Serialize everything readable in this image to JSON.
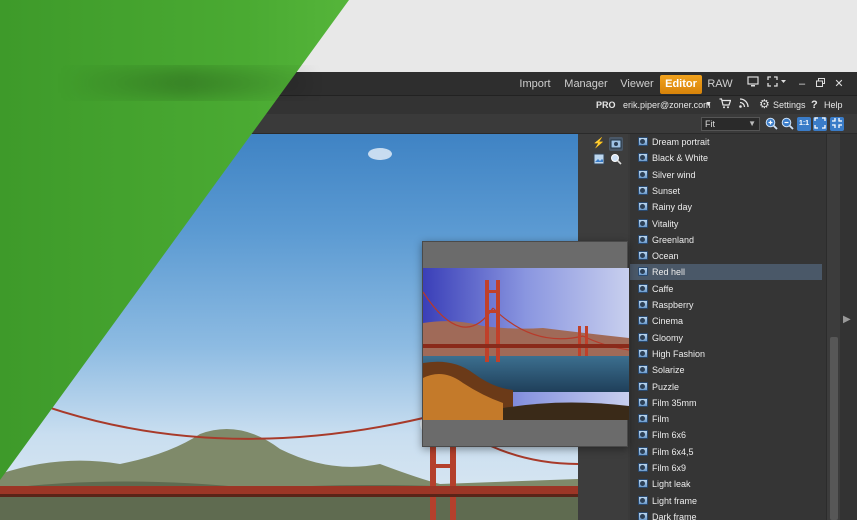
{
  "modules": {
    "import": "Import",
    "manager": "Manager",
    "viewer": "Viewer",
    "editor": "Editor",
    "raw": "RAW"
  },
  "window_controls": {
    "minimize": "‒",
    "restore": "🗗",
    "close": "✕"
  },
  "account": {
    "edition": "PRO",
    "email": "erik.piper@zoner.com",
    "settings": "Settings",
    "help": "Help"
  },
  "toolbar": {
    "zoom_value": "Fit"
  },
  "filters": {
    "selected": "Red hell",
    "items": [
      "Dream portrait",
      "Black & White",
      "Silver wind",
      "Sunset",
      "Rainy day",
      "Vitality",
      "Greenland",
      "Ocean",
      "Red hell",
      "Caffe",
      "Raspberry",
      "Cinema",
      "Gloomy",
      "High Fashion",
      "Solarize",
      "Puzzle",
      "Film 35mm",
      "Film",
      "Film 6x6",
      "Film 6x4,5",
      "Film 6x9",
      "Light leak",
      "Light frame",
      "Dark frame"
    ]
  },
  "colors": {
    "brand_green": "#4aaa32",
    "active_tab": "#e8960f",
    "selected_row": "#4a5868"
  }
}
